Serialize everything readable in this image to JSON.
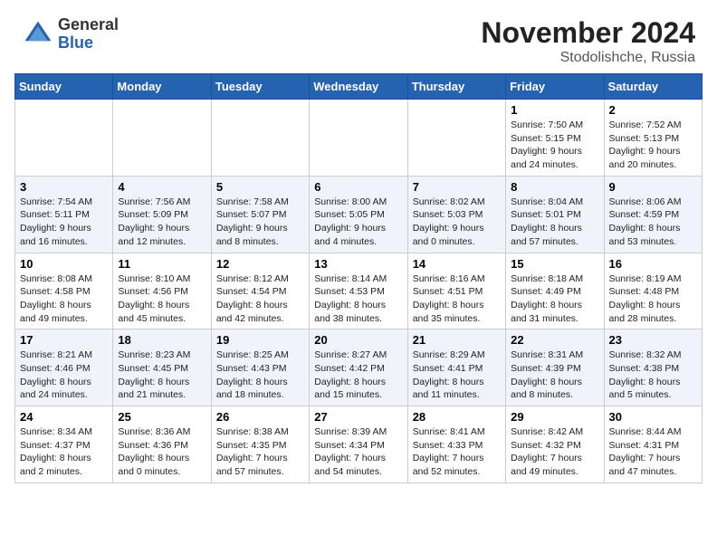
{
  "header": {
    "logo_general": "General",
    "logo_blue": "Blue",
    "month_title": "November 2024",
    "location": "Stodolishche, Russia"
  },
  "weekdays": [
    "Sunday",
    "Monday",
    "Tuesday",
    "Wednesday",
    "Thursday",
    "Friday",
    "Saturday"
  ],
  "weeks": [
    [
      {
        "day": "",
        "info": ""
      },
      {
        "day": "",
        "info": ""
      },
      {
        "day": "",
        "info": ""
      },
      {
        "day": "",
        "info": ""
      },
      {
        "day": "",
        "info": ""
      },
      {
        "day": "1",
        "info": "Sunrise: 7:50 AM\nSunset: 5:15 PM\nDaylight: 9 hours\nand 24 minutes."
      },
      {
        "day": "2",
        "info": "Sunrise: 7:52 AM\nSunset: 5:13 PM\nDaylight: 9 hours\nand 20 minutes."
      }
    ],
    [
      {
        "day": "3",
        "info": "Sunrise: 7:54 AM\nSunset: 5:11 PM\nDaylight: 9 hours\nand 16 minutes."
      },
      {
        "day": "4",
        "info": "Sunrise: 7:56 AM\nSunset: 5:09 PM\nDaylight: 9 hours\nand 12 minutes."
      },
      {
        "day": "5",
        "info": "Sunrise: 7:58 AM\nSunset: 5:07 PM\nDaylight: 9 hours\nand 8 minutes."
      },
      {
        "day": "6",
        "info": "Sunrise: 8:00 AM\nSunset: 5:05 PM\nDaylight: 9 hours\nand 4 minutes."
      },
      {
        "day": "7",
        "info": "Sunrise: 8:02 AM\nSunset: 5:03 PM\nDaylight: 9 hours\nand 0 minutes."
      },
      {
        "day": "8",
        "info": "Sunrise: 8:04 AM\nSunset: 5:01 PM\nDaylight: 8 hours\nand 57 minutes."
      },
      {
        "day": "9",
        "info": "Sunrise: 8:06 AM\nSunset: 4:59 PM\nDaylight: 8 hours\nand 53 minutes."
      }
    ],
    [
      {
        "day": "10",
        "info": "Sunrise: 8:08 AM\nSunset: 4:58 PM\nDaylight: 8 hours\nand 49 minutes."
      },
      {
        "day": "11",
        "info": "Sunrise: 8:10 AM\nSunset: 4:56 PM\nDaylight: 8 hours\nand 45 minutes."
      },
      {
        "day": "12",
        "info": "Sunrise: 8:12 AM\nSunset: 4:54 PM\nDaylight: 8 hours\nand 42 minutes."
      },
      {
        "day": "13",
        "info": "Sunrise: 8:14 AM\nSunset: 4:53 PM\nDaylight: 8 hours\nand 38 minutes."
      },
      {
        "day": "14",
        "info": "Sunrise: 8:16 AM\nSunset: 4:51 PM\nDaylight: 8 hours\nand 35 minutes."
      },
      {
        "day": "15",
        "info": "Sunrise: 8:18 AM\nSunset: 4:49 PM\nDaylight: 8 hours\nand 31 minutes."
      },
      {
        "day": "16",
        "info": "Sunrise: 8:19 AM\nSunset: 4:48 PM\nDaylight: 8 hours\nand 28 minutes."
      }
    ],
    [
      {
        "day": "17",
        "info": "Sunrise: 8:21 AM\nSunset: 4:46 PM\nDaylight: 8 hours\nand 24 minutes."
      },
      {
        "day": "18",
        "info": "Sunrise: 8:23 AM\nSunset: 4:45 PM\nDaylight: 8 hours\nand 21 minutes."
      },
      {
        "day": "19",
        "info": "Sunrise: 8:25 AM\nSunset: 4:43 PM\nDaylight: 8 hours\nand 18 minutes."
      },
      {
        "day": "20",
        "info": "Sunrise: 8:27 AM\nSunset: 4:42 PM\nDaylight: 8 hours\nand 15 minutes."
      },
      {
        "day": "21",
        "info": "Sunrise: 8:29 AM\nSunset: 4:41 PM\nDaylight: 8 hours\nand 11 minutes."
      },
      {
        "day": "22",
        "info": "Sunrise: 8:31 AM\nSunset: 4:39 PM\nDaylight: 8 hours\nand 8 minutes."
      },
      {
        "day": "23",
        "info": "Sunrise: 8:32 AM\nSunset: 4:38 PM\nDaylight: 8 hours\nand 5 minutes."
      }
    ],
    [
      {
        "day": "24",
        "info": "Sunrise: 8:34 AM\nSunset: 4:37 PM\nDaylight: 8 hours\nand 2 minutes."
      },
      {
        "day": "25",
        "info": "Sunrise: 8:36 AM\nSunset: 4:36 PM\nDaylight: 8 hours\nand 0 minutes."
      },
      {
        "day": "26",
        "info": "Sunrise: 8:38 AM\nSunset: 4:35 PM\nDaylight: 7 hours\nand 57 minutes."
      },
      {
        "day": "27",
        "info": "Sunrise: 8:39 AM\nSunset: 4:34 PM\nDaylight: 7 hours\nand 54 minutes."
      },
      {
        "day": "28",
        "info": "Sunrise: 8:41 AM\nSunset: 4:33 PM\nDaylight: 7 hours\nand 52 minutes."
      },
      {
        "day": "29",
        "info": "Sunrise: 8:42 AM\nSunset: 4:32 PM\nDaylight: 7 hours\nand 49 minutes."
      },
      {
        "day": "30",
        "info": "Sunrise: 8:44 AM\nSunset: 4:31 PM\nDaylight: 7 hours\nand 47 minutes."
      }
    ]
  ]
}
